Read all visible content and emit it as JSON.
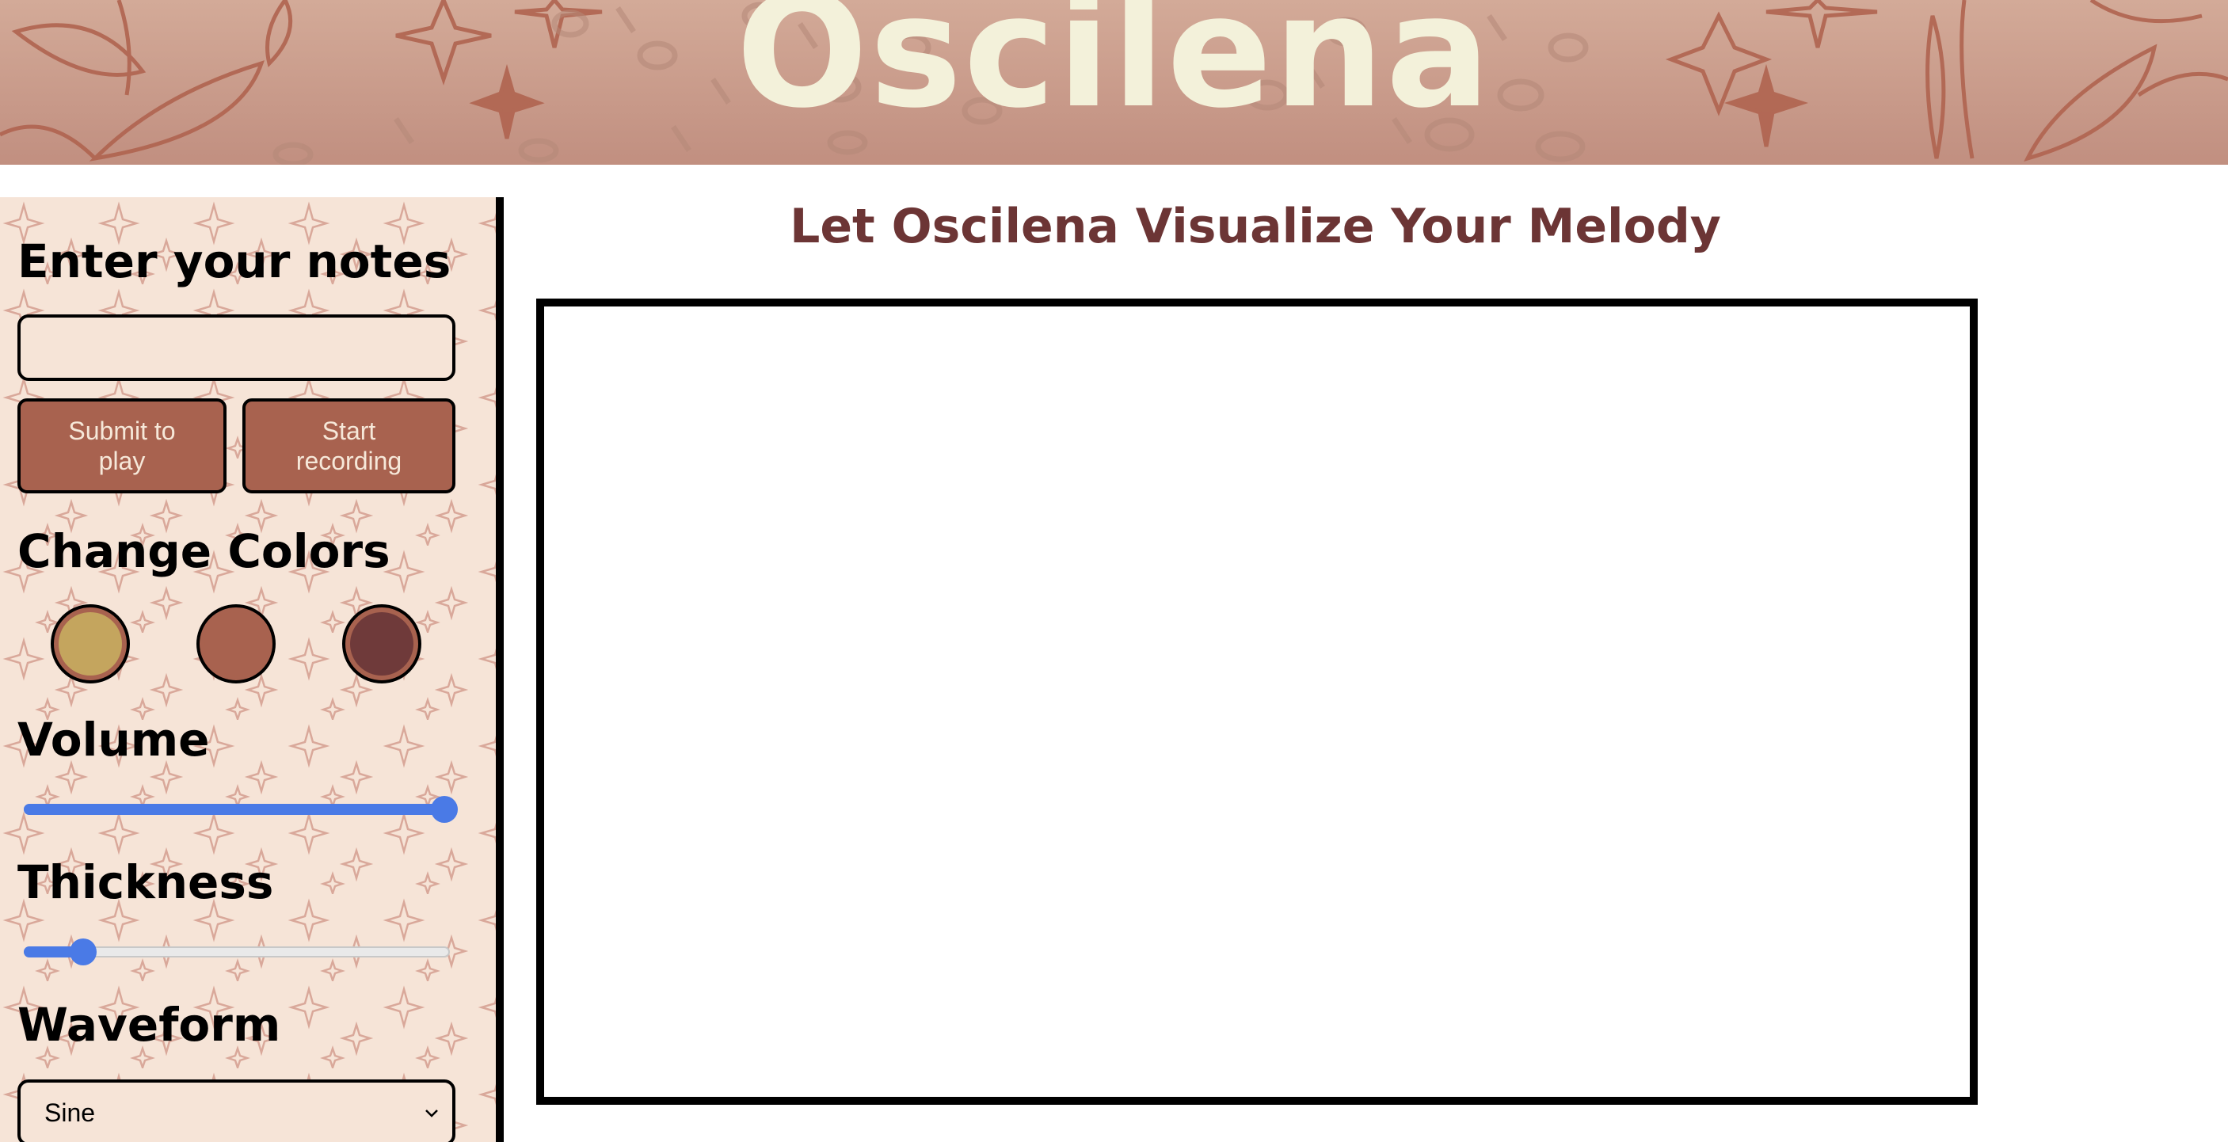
{
  "header": {
    "title": "Oscilena"
  },
  "sidebar": {
    "notes_heading": "Enter your notes",
    "notes_input_value": "",
    "notes_input_placeholder": "",
    "submit_label": "Submit to play",
    "record_label": "Start recording",
    "colors_heading": "Change Colors",
    "swatches": [
      {
        "name": "gold",
        "color": "#c4a55e"
      },
      {
        "name": "terracotta",
        "color": "#a8624f"
      },
      {
        "name": "maroon",
        "color": "#6f3a3a"
      }
    ],
    "volume_heading": "Volume",
    "volume_level": 1.0,
    "thickness_heading": "Thickness",
    "thickness_level": 0.13,
    "waveform_heading": "Waveform",
    "waveform_selected": "Sine"
  },
  "main": {
    "title": "Let Oscilena Visualize Your Melody"
  },
  "theme": {
    "accent": "#a8624f",
    "title_color": "#6c3535",
    "banner_text": "#f3f1da",
    "sidebar_bg": "#f6e4d7",
    "slider_color": "#4a7ae6"
  }
}
